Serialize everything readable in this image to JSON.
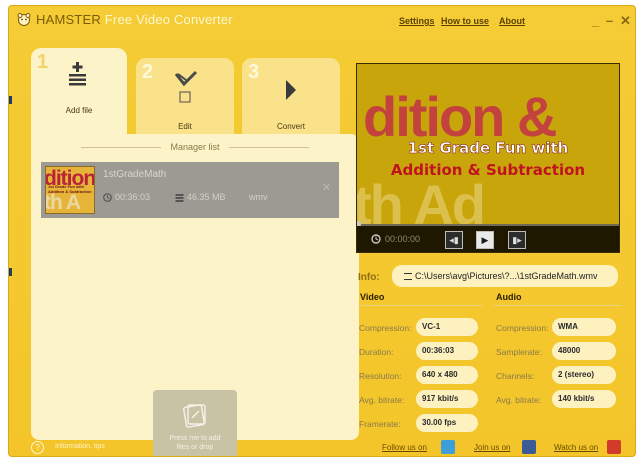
{
  "titlebar": {
    "app_name_dark": "HAMSTER",
    "app_name_light": " Free Video Converter",
    "menu": [
      "Settings",
      "How to use",
      "About"
    ],
    "minimize": "_",
    "restore": "–",
    "close": "✕"
  },
  "steps": [
    {
      "num": "1",
      "label": "Add file",
      "icon": "add-file-icon"
    },
    {
      "num": "2",
      "label": "Edit",
      "icon": "edit-icon"
    },
    {
      "num": "3",
      "label": "Convert",
      "icon": "convert-icon"
    }
  ],
  "manager": {
    "title": "Manager list",
    "file": {
      "name": "1stGradeMath",
      "duration": "00:36:03",
      "size": "46.35 MB",
      "format": "wmv",
      "thumb_text_top": "dition",
      "thumb_text_small": "1st Grade Fun with Addition & Subtraction",
      "thumb_text_bottom": "th A"
    },
    "add_box": {
      "line1": "Press me to add",
      "line2": "files or drop"
    }
  },
  "preview": {
    "bg_text_top": "dition &",
    "bg_text_bottom": "th Ad",
    "line1": "1st Grade Fun with",
    "line2": "Addition & Subtraction",
    "time": "00:00:00"
  },
  "info": {
    "label": "Info:",
    "path": "C:\\Users\\avg\\Pictures\\?...\\1stGradeMath.wmv",
    "video_title": "Video",
    "audio_title": "Audio",
    "video": [
      {
        "label": "Compression:",
        "value": "VC-1"
      },
      {
        "label": "Duration:",
        "value": "00:36:03"
      },
      {
        "label": "Resolution:",
        "value": "640 x 480"
      },
      {
        "label": "Avg. bitrate:",
        "value": "917 kbit/s"
      },
      {
        "label": "Framerate:",
        "value": "30.00 fps"
      }
    ],
    "audio": [
      {
        "label": "Compression:",
        "value": "WMA"
      },
      {
        "label": "Samplerate:",
        "value": "48000"
      },
      {
        "label": "Channels:",
        "value": "2 (stereo)"
      },
      {
        "label": "Avg. bitrate:",
        "value": "140 kbit/s"
      }
    ]
  },
  "statusbar": {
    "info_text": "Information, tips",
    "follow": "Follow us on",
    "join": "Join us on",
    "watch": "Watch us on"
  },
  "colors": {
    "window": "#f3c52a",
    "panel": "#fdf3c8",
    "selected_row": "#9c9a92",
    "preview_bg": "#c9a50c",
    "title_red": "#c0131f"
  }
}
